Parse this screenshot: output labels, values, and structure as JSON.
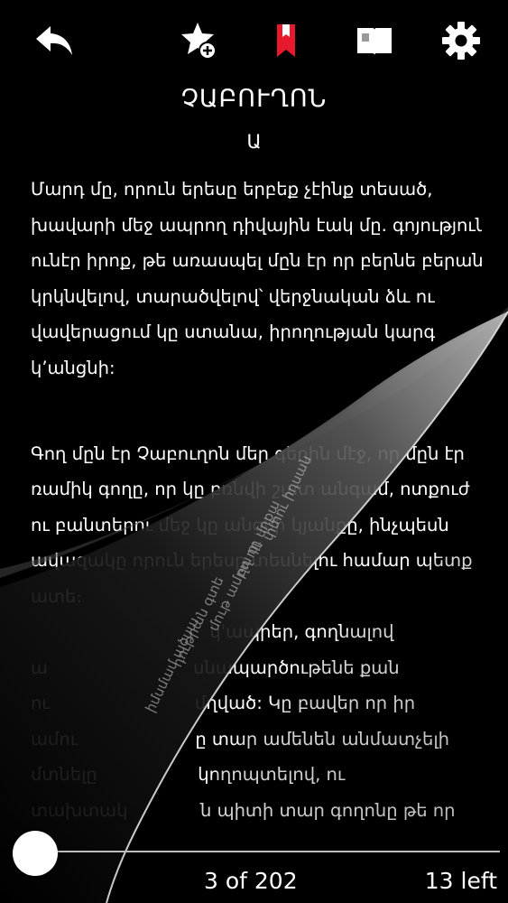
{
  "toolbar": {
    "back_icon": "back-arrow-icon",
    "add_bookmark_icon": "star-add-icon",
    "bookmark_icon": "bookmark-icon",
    "book_icon": "book-icon",
    "settings_icon": "gear-icon",
    "bookmark_color": "#e8192c"
  },
  "book": {
    "title": "ՉԱԲՈՒՂՈՆ",
    "chapter": "Ա"
  },
  "paragraphs": [
    {
      "lines": [
        "Մարդ մը, որուն երեսը երբեք չէինք տեսած,",
        "խավարի մեջ ապրող դիվային էակ մը. գոյություն",
        "ունէր իրոք, թե առասպել մըն էր որ բերնե բերան",
        "կրկնվելով, տարածվելով՝ վերջնական ձև ու",
        "վավերացում կը ստանա, իրողության կարգ",
        "կ՚անցնի:"
      ]
    },
    {
      "lines": [
        "Գող մըն էր Չաբուղոն մեր գեղին մէջ, որ մըն էր",
        "ռամիկ գողը, որ կը բռնվի շատ անգամ, ոտքուժ",
        "ու բանտերու մեջ կը անցնի կյանքը, ինչպեսն",
        "ավազակը որուն երեսը տեսնելու համար պետք",
        "ատե։",
        "",
        "                                կ'ապրեր, գողնալով",
        "ա                          սնապարծութենե քան",
        "ու                          մղված: Կը բավեր որ իր",
        "ամու                     ը տար ամենեն անմատչելի",
        "մտնելը                  կողոպտելով, ու",
        "տախտակ             ն պիտի տար գողոնը թե որ"
      ]
    }
  ],
  "footer": {
    "page_indicator": "3 of 202",
    "pages_left": "13 left",
    "progress": 0.01
  }
}
